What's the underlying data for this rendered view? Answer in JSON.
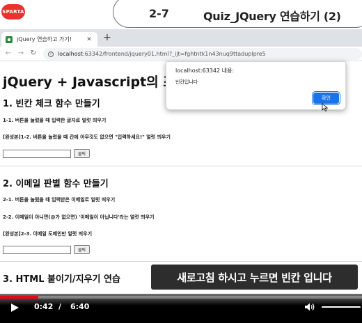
{
  "lecture": {
    "logo_text": "SPARTA",
    "lesson_number": "2-7",
    "lesson_title": "Quiz_JQuery 연습하기 (2)"
  },
  "browser": {
    "tab_title": "jQuery 연습하고 가기!",
    "tab_close": "✕",
    "new_tab": "+",
    "back": "←",
    "forward": "→",
    "reload": "↻",
    "url_host": "localhost",
    "url_rest": ":63342/frontend/jquery01.html?_ijt=fghtntk1n43nuq9ttaduplpre5"
  },
  "page": {
    "main_title": "jQuery + Javascript의 조합을 연습하자!",
    "section1": {
      "heading": "1. 빈칸 체크 함수 만들기",
      "line1": "1-1. 버튼을 눌렀을 때 입력한 글자로 얼럿 띄우기",
      "line2": "[완성본]1-2. 버튼을 눌렀을 때 칸에 아무것도 없으면 \"입력하세요!\" 얼럿 띄우기",
      "button": "클릭"
    },
    "section2": {
      "heading": "2. 이메일 판별 함수 만들기",
      "line1": "2-1. 버튼을 눌렀을 때 입력받은 이메일로 얼럿 띄우기",
      "line2": "2-2. 이메일이 아니면(@가 없으면) '이메일이 아닙니다'라는 얼럿 띄우기",
      "line3": "[완성본]2-3. 이메일 도메인만 얼럿 띄우기",
      "button": "클릭"
    },
    "section3": {
      "heading": "3. HTML 붙이기/지우기 연습"
    }
  },
  "dialog": {
    "title": "localhost:63342 내용:",
    "message": "빈칸입니다",
    "ok_label": "확인"
  },
  "caption": "새로고침 하시고 누르면 빈칸 입니다",
  "player": {
    "current_time": "0:42",
    "separator": "/",
    "total_time": "6:40",
    "progress_fraction": 0.105,
    "accent_color": "#e50914"
  }
}
